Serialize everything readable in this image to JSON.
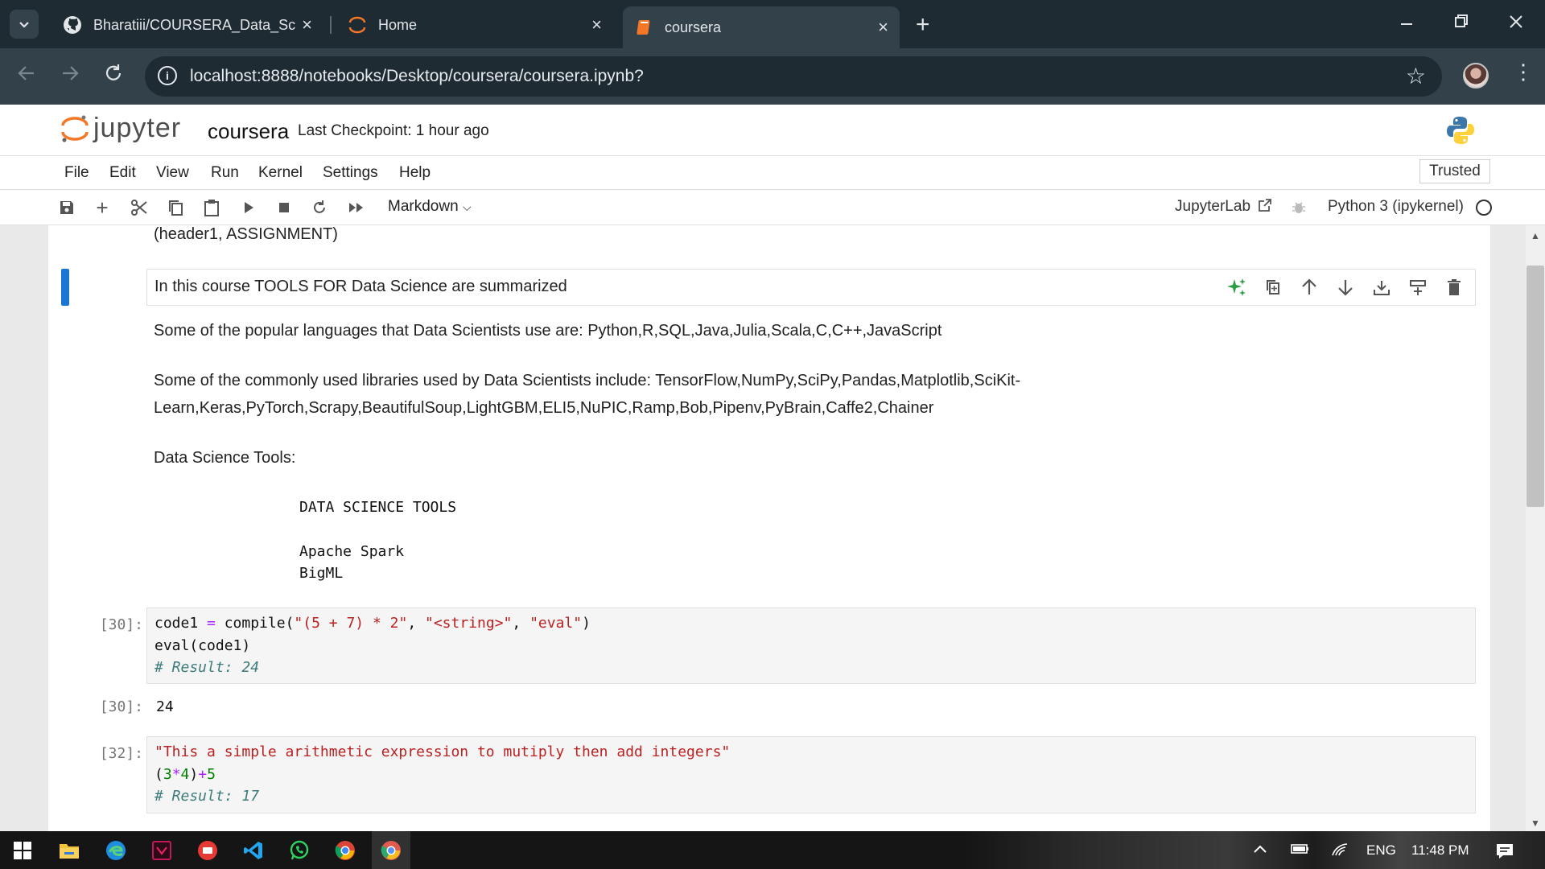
{
  "browser": {
    "tabs": [
      {
        "title": "Bharatiii/COURSERA_Data_Scier",
        "icon": "github-icon",
        "active": false
      },
      {
        "title": "Home",
        "icon": "jupyter-icon",
        "active": false
      },
      {
        "title": "coursera",
        "icon": "notebook-icon",
        "active": true
      }
    ],
    "url": "localhost:8888/notebooks/Desktop/coursera/coursera.ipynb?"
  },
  "jupyter": {
    "logo_text": "jupyter",
    "notebook_name": "coursera",
    "checkpoint": "Last Checkpoint: 1 hour ago",
    "menu": [
      "File",
      "Edit",
      "View",
      "Run",
      "Kernel",
      "Settings",
      "Help"
    ],
    "trusted": "Trusted",
    "cell_type": "Markdown",
    "jupyterlab_link": "JupyterLab",
    "kernel_name": "Python 3 (ipykernel)"
  },
  "notebook": {
    "top_text": "(header1, ASSIGNMENT)",
    "active_cell_text": "In this course TOOLS FOR Data Science are summarized",
    "para_languages": "Some of the popular languages that Data Scientists use are: Python,R,SQL,Java,Julia,Scala,C,C++,JavaScript",
    "para_libraries_1": "Some of the commonly used libraries used by Data Scientists include: TensorFlow,NumPy,SciPy,Pandas,Matplotlib,SciKit-",
    "para_libraries_2": "Learn,Keras,PyTorch,Scrapy,BeautifulSoup,LightGBM,ELI5,NuPIC,Ramp,Bob,Pipenv,PyBrain,Caffe2,Chainer",
    "tools_heading": "Data Science Tools:",
    "table_header": "DATA SCIENCE TOOLS",
    "table_rows": [
      "Apache Spark",
      "BigML"
    ],
    "cell30": {
      "prompt": "[30]:",
      "line1_a": "code1 ",
      "line1_eq": "=",
      "line1_b": " compile(",
      "line1_s1": "\"(5 + 7) * 2\"",
      "line1_c1": ", ",
      "line1_s2": "\"<string>\"",
      "line1_c2": ", ",
      "line1_s3": "\"eval\"",
      "line1_end": ")",
      "line2": "eval(code1)",
      "line3": "# Result: 24",
      "out_prompt": "[30]:",
      "output": "24"
    },
    "cell32": {
      "prompt": "[32]:",
      "line1": "\"This a simple arithmetic expression to mutiply then add integers\"",
      "line2_a": "(",
      "line2_n1": "3",
      "line2_op": "*",
      "line2_n2": "4",
      "line2_b": ")",
      "line2_plus": "+",
      "line2_n3": "5",
      "line3": "# Result: 17"
    }
  },
  "taskbar": {
    "language": "ENG",
    "time": "11:48 PM"
  },
  "colors": {
    "chrome_dark": "#1f2b33",
    "chrome_tab": "#33414a",
    "jupyter_orange": "#f37726",
    "active_cell_blue": "#1976d2",
    "ai_green": "#2e9c44"
  }
}
